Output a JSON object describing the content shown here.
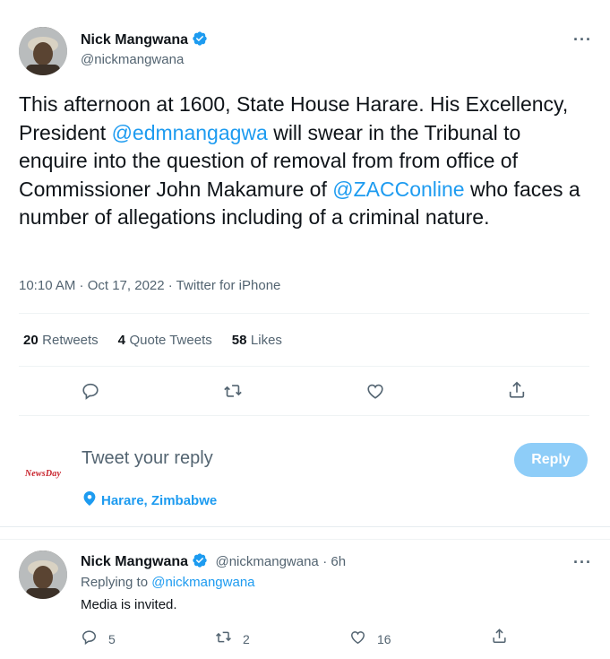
{
  "main_tweet": {
    "author_name": "Nick Mangwana",
    "author_handle": "@nickmangwana",
    "text_1": "This afternoon at 1600, State House Harare. His Excellency, President ",
    "mention_1": "@edmnangagwa",
    "text_2": " will swear in the Tribunal to enquire into the question of removal from from office of Commissioner John Makamure of ",
    "mention_2": "@ZACConline",
    "text_3": " who faces a number of allegations including of a criminal nature.",
    "meta": "10:10 AM · Oct 17, 2022 · Twitter for iPhone",
    "retweets_count": "20",
    "retweets_label": "Retweets",
    "quotes_count": "4",
    "quotes_label": "Quote Tweets",
    "likes_count": "58",
    "likes_label": "Likes",
    "more_label": "···"
  },
  "composer": {
    "avatar_text": "NewsDay",
    "placeholder": "Tweet your reply",
    "reply_button": "Reply",
    "location": "Harare, Zimbabwe"
  },
  "reply_tweet": {
    "author_name": "Nick Mangwana",
    "author_handle": "@nickmangwana",
    "time": "· 6h",
    "replying_prefix": "Replying to ",
    "replying_to": "@nickmangwana",
    "text": "Media is invited.",
    "reply_count": "5",
    "retweet_count": "2",
    "like_count": "16",
    "more_label": "···"
  },
  "colors": {
    "accent": "#1d9bf0",
    "reply_button_disabled": "#8ecdf8",
    "muted_text": "#536471",
    "divider": "#eff3f4"
  },
  "icons": {
    "verified": "verified-badge-icon",
    "reply": "reply-icon",
    "retweet": "retweet-icon",
    "like": "heart-icon",
    "share": "share-icon",
    "location": "location-pin-icon",
    "more": "more-icon"
  }
}
